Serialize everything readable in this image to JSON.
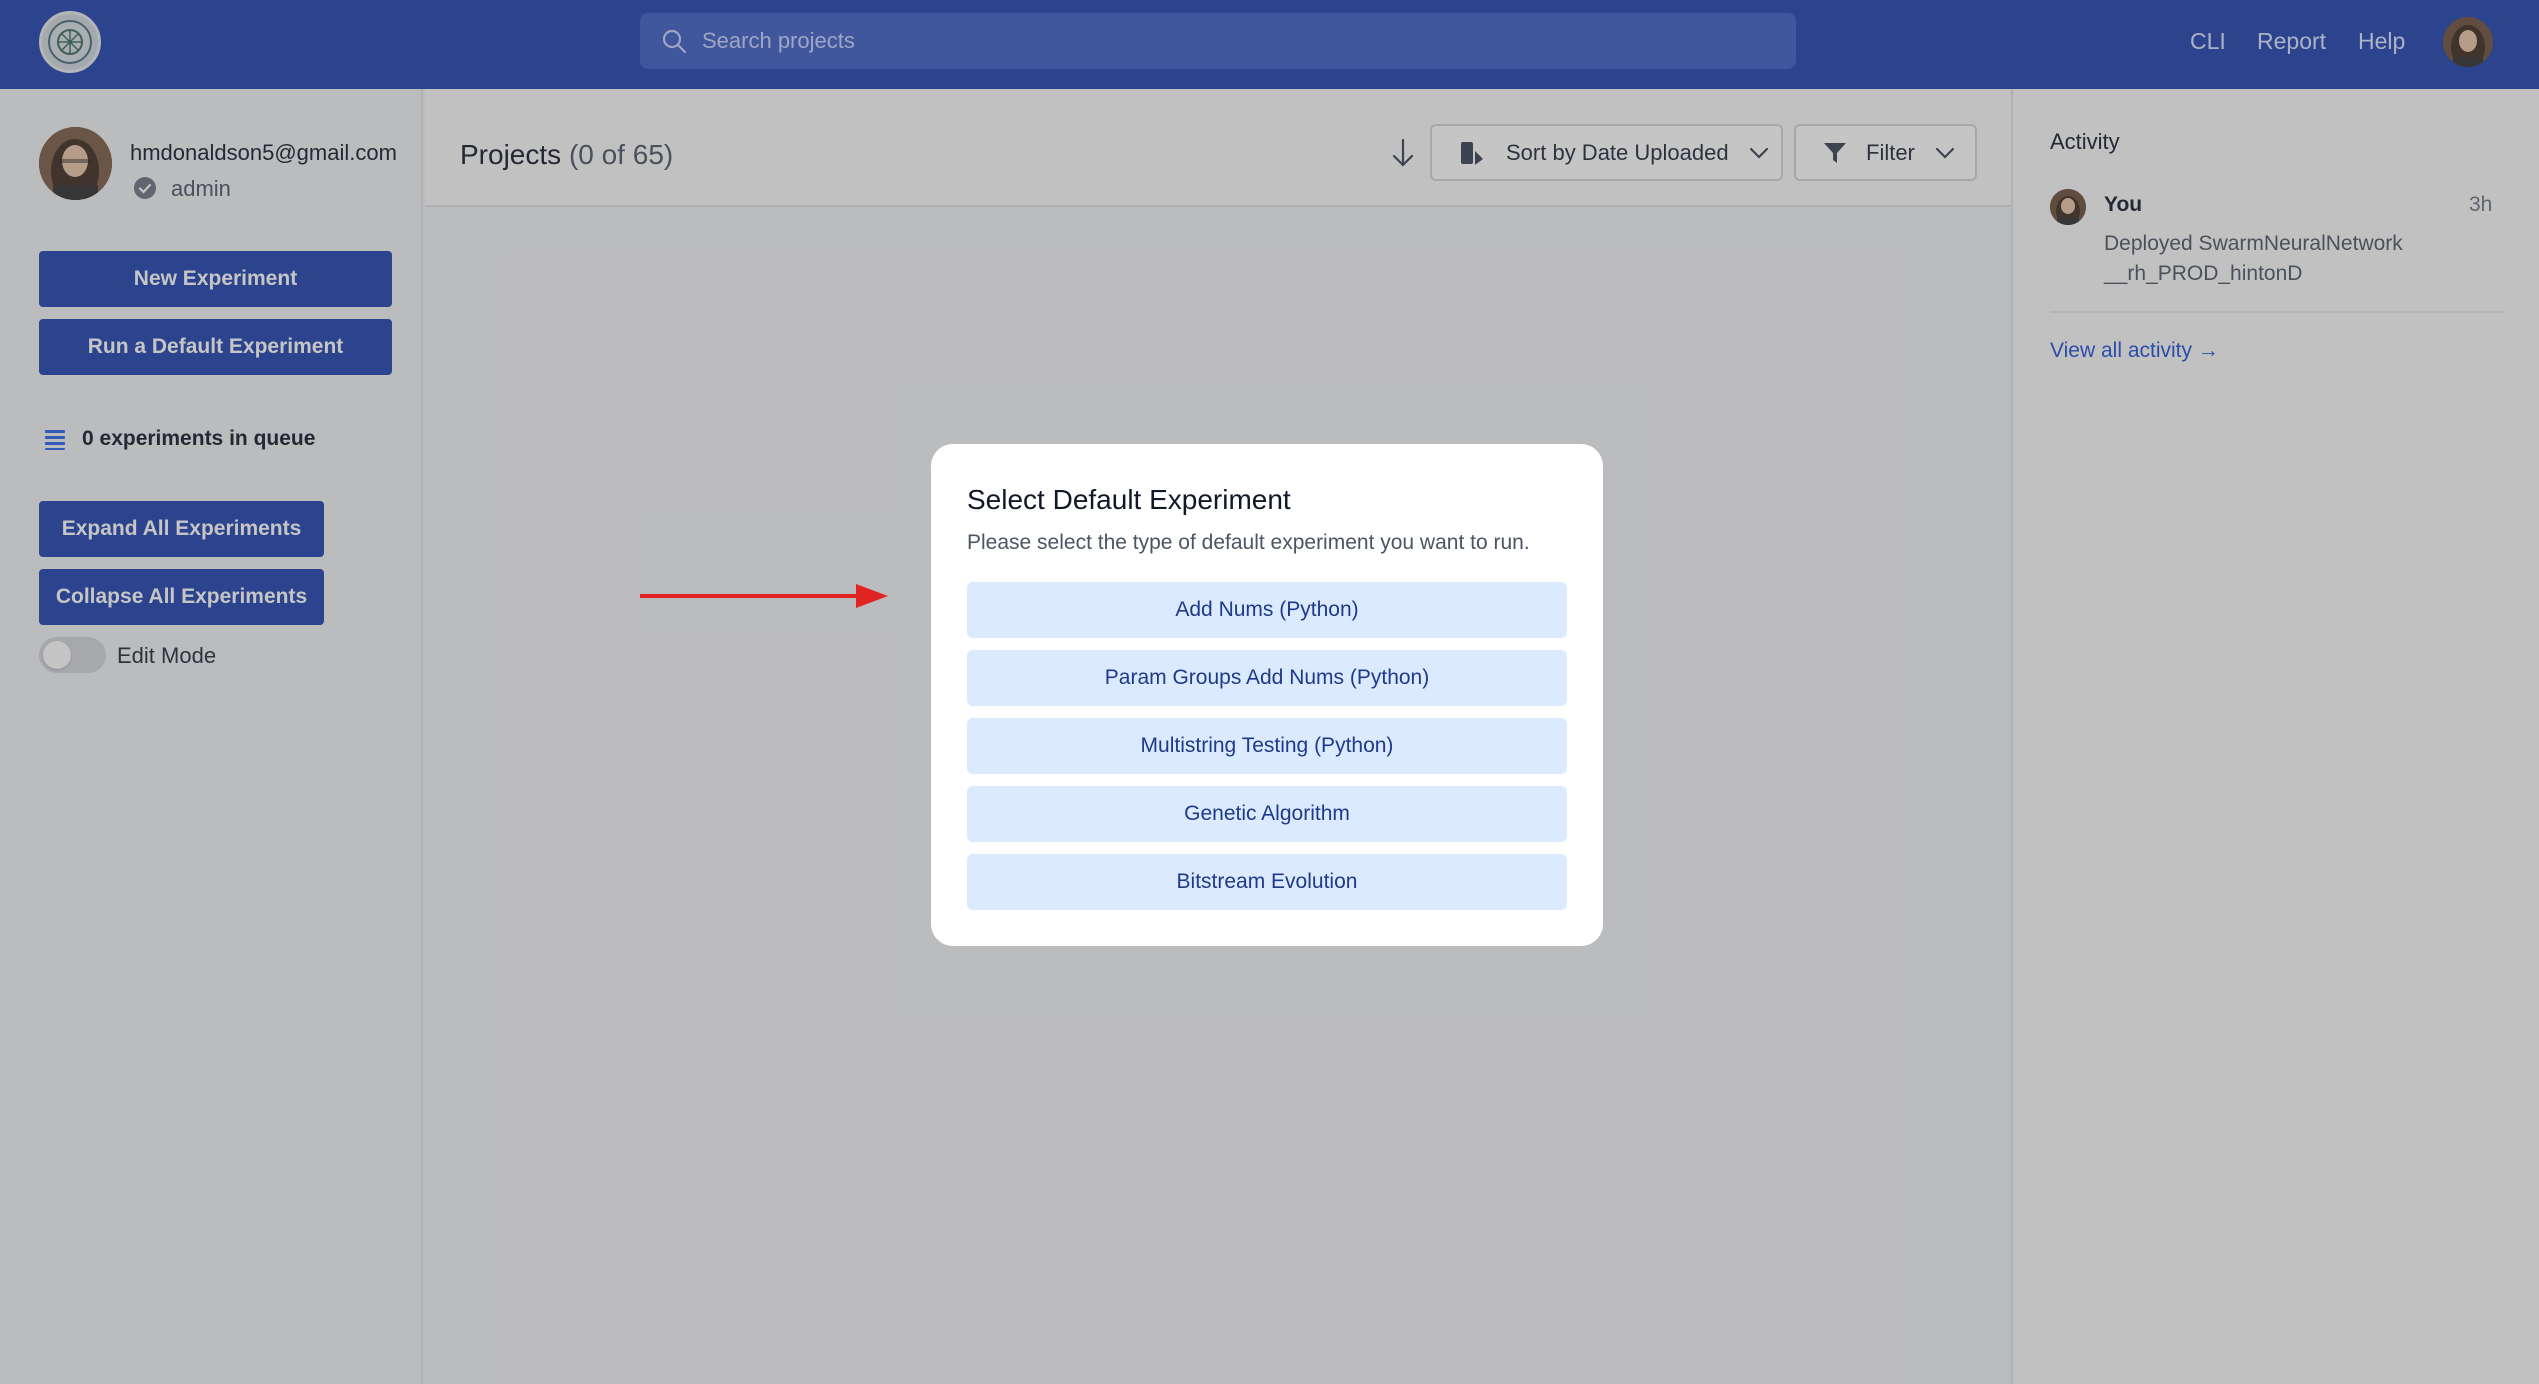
{
  "topbar": {
    "logo_icon": "org-globe-logo",
    "search_placeholder": "Search projects",
    "nav": [
      "CLI",
      "Report",
      "Help"
    ]
  },
  "sidebar": {
    "email": "hmdonaldson5@gmail.com",
    "role": "admin",
    "new_experiment": "New Experiment",
    "run_default": "Run a Default Experiment",
    "queue": "0 experiments in queue",
    "expand_all": "Expand All Experiments",
    "collapse_all": "Collapse All Experiments",
    "edit_mode": "Edit Mode",
    "edit_mode_on": false
  },
  "main": {
    "title": "Projects",
    "count": "(0 of 65)",
    "sort_label": "Sort by Date Uploaded",
    "filter_label": "Filter"
  },
  "activity": {
    "title": "Activity",
    "items": [
      {
        "user": "You",
        "time": "3h",
        "desc_line1": "Deployed SwarmNeuralNetwork",
        "desc_line2": "__rh_PROD_hintonD"
      }
    ],
    "view_all": "View all activity →"
  },
  "modal": {
    "title": "Select Default Experiment",
    "subtitle": "Please select the type of default experiment you want to run.",
    "options": [
      "Add Nums (Python)",
      "Param Groups Add Nums (Python)",
      "Multistring Testing (Python)",
      "Genetic Algorithm",
      "Bitstream Evolution"
    ]
  },
  "colors": {
    "brand": "#1e40af",
    "option_bg": "#dbeafe",
    "arrow": "#e02424"
  }
}
